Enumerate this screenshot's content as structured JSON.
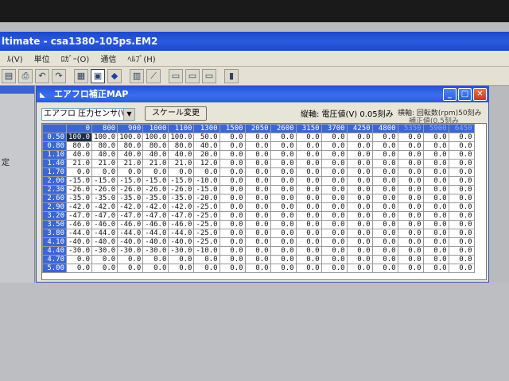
{
  "app_title": "ltimate - csa1380-105ps.EM2",
  "menu": [
    "ﾙ(V)",
    "単位",
    "ﾛｶﾞｰ(O)",
    "通信",
    "ﾍﾙﾌﾟ(H)"
  ],
  "toolbar_icons": [
    "save-icon",
    "print-icon",
    "undo-icon",
    "redo-icon",
    "table-icon",
    "window-icon",
    "car-icon",
    "graph-icon",
    "chart-icon",
    "module-icon",
    "module-icon",
    "module-icon",
    "logger-icon"
  ],
  "left_label": "定",
  "window_title": "エアフロ補正MAP",
  "map_select": "エアフロ 圧力センサ(V)",
  "scale_button": "スケール変更",
  "vertical_axis": "縦軸: 電圧値(V) 0.05刻み",
  "horizontal_axis": "横軸: 回転数(rpm)50刻み",
  "horizontal_axis_2": "補正値(0.5刻み",
  "col_headers": [
    "0",
    "800",
    "900",
    "1000",
    "1100",
    "1300",
    "1500",
    "2050",
    "2600",
    "3150",
    "3700",
    "4250",
    "4800",
    "5350",
    "5900",
    "6450"
  ],
  "rows": [
    {
      "v": "0.50",
      "c": [
        "100.0",
        "100.0",
        "100.0",
        "100.0",
        "100.0",
        "50.0",
        "0.0",
        "0.0",
        "0.0",
        "0.0",
        "0.0",
        "0.0",
        "0.0",
        "0.0",
        "0.0",
        "0.0"
      ]
    },
    {
      "v": "0.80",
      "c": [
        "80.0",
        "80.0",
        "80.0",
        "80.0",
        "80.0",
        "40.0",
        "0.0",
        "0.0",
        "0.0",
        "0.0",
        "0.0",
        "0.0",
        "0.0",
        "0.0",
        "0.0",
        "0.0"
      ]
    },
    {
      "v": "1.10",
      "c": [
        "40.0",
        "40.0",
        "40.0",
        "40.0",
        "40.0",
        "20.0",
        "0.0",
        "0.0",
        "0.0",
        "0.0",
        "0.0",
        "0.0",
        "0.0",
        "0.0",
        "0.0",
        "0.0"
      ]
    },
    {
      "v": "1.40",
      "c": [
        "21.0",
        "21.0",
        "21.0",
        "21.0",
        "21.0",
        "12.0",
        "0.0",
        "0.0",
        "0.0",
        "0.0",
        "0.0",
        "0.0",
        "0.0",
        "0.0",
        "0.0",
        "0.0"
      ]
    },
    {
      "v": "1.70",
      "c": [
        "0.0",
        "0.0",
        "0.0",
        "0.0",
        "0.0",
        "0.0",
        "0.0",
        "0.0",
        "0.0",
        "0.0",
        "0.0",
        "0.0",
        "0.0",
        "0.0",
        "0.0",
        "0.0"
      ]
    },
    {
      "v": "2.00",
      "c": [
        "-15.0",
        "-15.0",
        "-15.0",
        "-15.0",
        "-15.0",
        "-10.0",
        "0.0",
        "0.0",
        "0.0",
        "0.0",
        "0.0",
        "0.0",
        "0.0",
        "0.0",
        "0.0",
        "0.0"
      ]
    },
    {
      "v": "2.30",
      "c": [
        "-26.0",
        "-26.0",
        "-26.0",
        "-26.0",
        "-26.0",
        "-15.0",
        "0.0",
        "0.0",
        "0.0",
        "0.0",
        "0.0",
        "0.0",
        "0.0",
        "0.0",
        "0.0",
        "0.0"
      ]
    },
    {
      "v": "2.60",
      "c": [
        "-35.0",
        "-35.0",
        "-35.0",
        "-35.0",
        "-35.0",
        "-20.0",
        "0.0",
        "0.0",
        "0.0",
        "0.0",
        "0.0",
        "0.0",
        "0.0",
        "0.0",
        "0.0",
        "0.0"
      ]
    },
    {
      "v": "2.90",
      "c": [
        "-42.0",
        "-42.0",
        "-42.0",
        "-42.0",
        "-42.0",
        "-25.0",
        "0.0",
        "0.0",
        "0.0",
        "0.0",
        "0.0",
        "0.0",
        "0.0",
        "0.0",
        "0.0",
        "0.0"
      ]
    },
    {
      "v": "3.20",
      "c": [
        "-47.0",
        "-47.0",
        "-47.0",
        "-47.0",
        "-47.0",
        "-25.0",
        "0.0",
        "0.0",
        "0.0",
        "0.0",
        "0.0",
        "0.0",
        "0.0",
        "0.0",
        "0.0",
        "0.0"
      ]
    },
    {
      "v": "3.50",
      "c": [
        "-46.0",
        "-46.0",
        "-46.0",
        "-46.0",
        "-46.0",
        "-25.0",
        "0.0",
        "0.0",
        "0.0",
        "0.0",
        "0.0",
        "0.0",
        "0.0",
        "0.0",
        "0.0",
        "0.0"
      ]
    },
    {
      "v": "3.80",
      "c": [
        "-44.0",
        "-44.0",
        "-44.0",
        "-44.0",
        "-44.0",
        "-25.0",
        "0.0",
        "0.0",
        "0.0",
        "0.0",
        "0.0",
        "0.0",
        "0.0",
        "0.0",
        "0.0",
        "0.0"
      ]
    },
    {
      "v": "4.10",
      "c": [
        "-40.0",
        "-40.0",
        "-40.0",
        "-40.0",
        "-40.0",
        "-25.0",
        "0.0",
        "0.0",
        "0.0",
        "0.0",
        "0.0",
        "0.0",
        "0.0",
        "0.0",
        "0.0",
        "0.0"
      ]
    },
    {
      "v": "4.40",
      "c": [
        "-30.0",
        "-30.0",
        "-30.0",
        "-30.0",
        "-30.0",
        "-10.0",
        "0.0",
        "0.0",
        "0.0",
        "0.0",
        "0.0",
        "0.0",
        "0.0",
        "0.0",
        "0.0",
        "0.0"
      ]
    },
    {
      "v": "4.70",
      "c": [
        "0.0",
        "0.0",
        "0.0",
        "0.0",
        "0.0",
        "0.0",
        "0.0",
        "0.0",
        "0.0",
        "0.0",
        "0.0",
        "0.0",
        "0.0",
        "0.0",
        "0.0",
        "0.0"
      ]
    },
    {
      "v": "5.00",
      "c": [
        "0.0",
        "0.0",
        "0.0",
        "0.0",
        "0.0",
        "0.0",
        "0.0",
        "0.0",
        "0.0",
        "0.0",
        "0.0",
        "0.0",
        "0.0",
        "0.0",
        "0.0",
        "0.0"
      ]
    }
  ],
  "colors": {
    "titlebar": "#2456d7",
    "header": "#3b66d4",
    "selected_cell": "#1b2c46"
  }
}
